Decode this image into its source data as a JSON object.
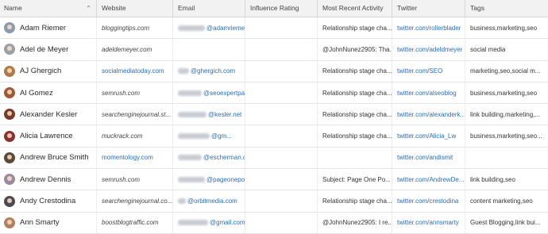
{
  "headers": {
    "name": "Name",
    "website": "Website",
    "email": "Email",
    "influence": "Influence Rating",
    "activity": "Most Recent Activity",
    "twitter": "Twitter",
    "tags": "Tags"
  },
  "sort_icon": "chevron-up-icon",
  "rows": [
    {
      "name": "Adam Riemer",
      "avatar_color": "#8a9bb0",
      "website": "bloggingtips.com",
      "website_is_link": false,
      "email_suffix": "@adamriemer.me",
      "activity": "Relationship stage cha...",
      "twitter": "twitter.com/rollerblader",
      "tags": "business,marketing,seo"
    },
    {
      "name": "Adel de Meyer",
      "avatar_color": "#9aa0a8",
      "website": "adeldemeyer.com",
      "website_is_link": false,
      "email_suffix": "",
      "activity": "@JohnNunez2905: Tha...",
      "twitter": "twitter.com/adeldmeyer",
      "tags": "social media"
    },
    {
      "name": "AJ Ghergich",
      "avatar_color": "#b07a4a",
      "website": "socialmediatoday.com",
      "website_is_link": true,
      "email_suffix": "@ghergich.com",
      "activity": "Relationship stage cha...",
      "twitter": "twitter.com/SEO",
      "tags": "marketing,seo,social m..."
    },
    {
      "name": "Al Gomez",
      "avatar_color": "#a05a3a",
      "website": "semrush.com",
      "website_is_link": false,
      "email_suffix": "@seoexpertpage.com",
      "activity": "Relationship stage cha...",
      "twitter": "twitter.com/alseoblog",
      "tags": "business,marketing,seo"
    },
    {
      "name": "Alexander Kesler",
      "avatar_color": "#7a3a2a",
      "website": "searchenginejournal.st...",
      "website_is_link": false,
      "email_suffix": "@kesler.net",
      "activity": "Relationship stage cha...",
      "twitter": "twitter.com/alexanderk...",
      "tags": "link building,marketing,..."
    },
    {
      "name": "Alicia Lawrence",
      "avatar_color": "#8a3030",
      "website": "muckrack.com",
      "website_is_link": false,
      "email_suffix": "@gm...",
      "activity": "Relationship stage cha...",
      "twitter": "twitter.com/Alicia_Lw",
      "tags": "business,marketing,seo..."
    },
    {
      "name": "Andrew Bruce Smith",
      "avatar_color": "#5a4a3a",
      "website": "momentology.com",
      "website_is_link": true,
      "email_suffix": "@escherman.co...",
      "activity": "",
      "twitter": "twitter.com/andismit",
      "tags": ""
    },
    {
      "name": "Andrew Dennis",
      "avatar_color": "#9a8aa0",
      "website": "semrush.com",
      "website_is_link": false,
      "email_suffix": "@pageonepow...",
      "activity": "Subject: Page One Po...",
      "twitter": "twitter.com/AndrewDe...",
      "tags": "link building,seo"
    },
    {
      "name": "Andy Crestodina",
      "avatar_color": "#4a4a52",
      "website": "searchenginejournal.co...",
      "website_is_link": false,
      "email_suffix": "@orbitmedia.com",
      "activity": "Relationship stage cha...",
      "twitter": "twitter.com/crestodina",
      "tags": "content marketing,seo"
    },
    {
      "name": "Ann Smarty",
      "avatar_color": "#b08060",
      "website": "boostblogtraffic.com",
      "website_is_link": false,
      "email_suffix": "@gmail.com",
      "activity": "@JohnNunez2905: I re...",
      "twitter": "twitter.com/annsmarty",
      "tags": "Guest Blogging,link bui..."
    }
  ]
}
